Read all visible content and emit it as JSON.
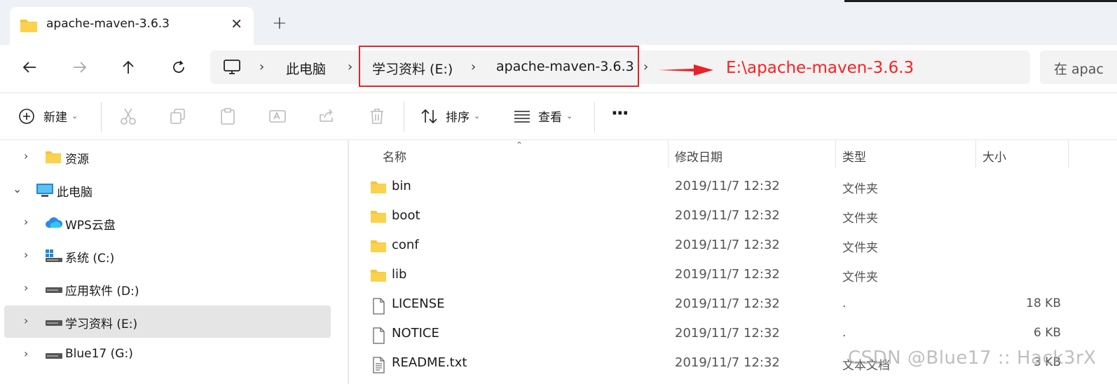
{
  "tab": {
    "title": "apache-maven-3.6.3",
    "close": "✕",
    "new_tab": "+"
  },
  "nav": {
    "back": "←",
    "forward": "→",
    "up": "↑",
    "refresh": "↻"
  },
  "breadcrumb": {
    "sep": "›",
    "items": [
      "此电脑",
      "学习资料 (E:)",
      "apache-maven-3.6.3"
    ]
  },
  "annotation": {
    "text": "E:\\apache-maven-3.6.3",
    "color": "#ff2020"
  },
  "search": {
    "placeholder": "在 apac"
  },
  "toolbar": {
    "new_label": "新建",
    "sort_label": "排序",
    "view_label": "查看",
    "more": "···",
    "dropdown": "⌄"
  },
  "sidebar": {
    "items": [
      {
        "label": "资源",
        "icon": "folder-icon",
        "arrow": "›"
      },
      {
        "label": "此电脑",
        "icon": "pc-icon",
        "arrow": "⌄"
      },
      {
        "label": "WPS云盘",
        "icon": "cloud-icon",
        "arrow": "›"
      },
      {
        "label": "系统 (C:)",
        "icon": "system-drive-icon",
        "arrow": "›"
      },
      {
        "label": "应用软件 (D:)",
        "icon": "drive-icon",
        "arrow": "›"
      },
      {
        "label": "学习资料 (E:)",
        "icon": "drive-icon",
        "arrow": "›"
      },
      {
        "label": "Blue17 (G:)",
        "icon": "drive-icon",
        "arrow": "›"
      }
    ]
  },
  "columns": {
    "name": "名称",
    "modified": "修改日期",
    "type": "类型",
    "size": "大小",
    "sort_arrow": "⌃"
  },
  "files": [
    {
      "name": "bin",
      "date": "2019/11/7 12:32",
      "type": "文件夹",
      "size": "",
      "icon": "folder-icon"
    },
    {
      "name": "boot",
      "date": "2019/11/7 12:32",
      "type": "文件夹",
      "size": "",
      "icon": "folder-icon"
    },
    {
      "name": "conf",
      "date": "2019/11/7 12:32",
      "type": "文件夹",
      "size": "",
      "icon": "folder-icon"
    },
    {
      "name": "lib",
      "date": "2019/11/7 12:32",
      "type": "文件夹",
      "size": "",
      "icon": "folder-icon"
    },
    {
      "name": "LICENSE",
      "date": "2019/11/7 12:32",
      "type": ".",
      "size": "18 KB",
      "icon": "file-icon"
    },
    {
      "name": "NOTICE",
      "date": "2019/11/7 12:32",
      "type": ".",
      "size": "6 KB",
      "icon": "file-icon"
    },
    {
      "name": "README.txt",
      "date": "2019/11/7 12:32",
      "type": "文本文档",
      "size": "3 KB",
      "icon": "text-file-icon"
    }
  ],
  "watermark": "CSDN @Blue17 :: Hack3rX",
  "colors": {
    "accent": "#e8212a",
    "folder": "#f8c537",
    "selected": "#e5e5e5"
  }
}
